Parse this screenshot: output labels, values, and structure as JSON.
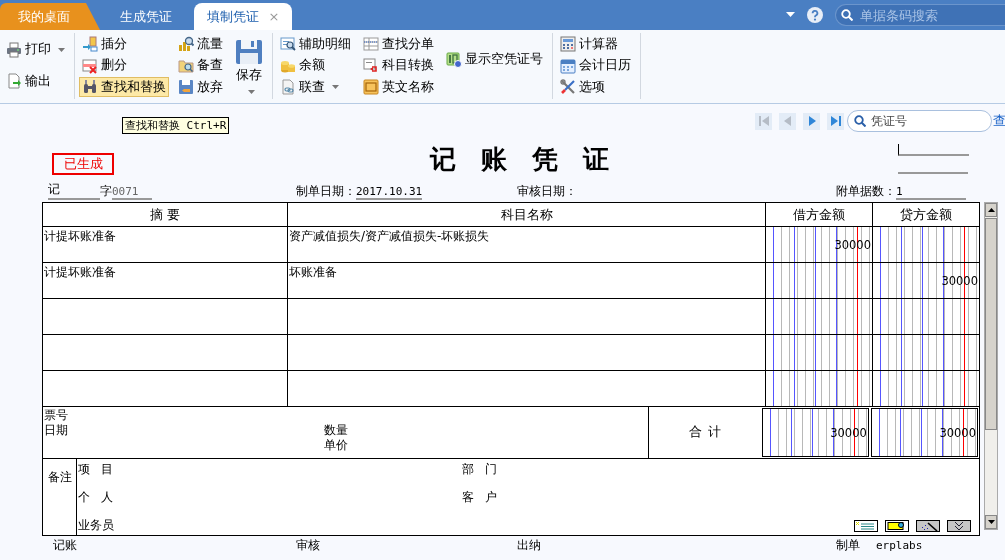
{
  "tabs": [
    {
      "label": "我的桌面",
      "selected": false,
      "kind": "home"
    },
    {
      "label": "生成凭证",
      "selected": false,
      "kind": "normal"
    },
    {
      "label": "填制凭证",
      "selected": true,
      "kind": "normal",
      "close": "×"
    }
  ],
  "barcode_search": {
    "placeholder": "单据条码搜索"
  },
  "ribbon": {
    "groups": [
      {
        "columns": [
          [
            {
              "label": "打印",
              "kind": "small",
              "dropdown": true,
              "hovered": false
            },
            {
              "label": "输出",
              "kind": "small",
              "dropdown": false,
              "hovered": false
            }
          ]
        ]
      },
      {
        "columns": [
          [
            {
              "label": "插分",
              "kind": "small",
              "dropdown": false,
              "hovered": false
            },
            {
              "label": "删分",
              "kind": "small",
              "dropdown": false,
              "hovered": false
            },
            {
              "label": "查找和替换",
              "kind": "small",
              "dropdown": false,
              "hovered": true
            }
          ],
          [
            {
              "label": "流量",
              "kind": "small",
              "dropdown": false,
              "hovered": false
            },
            {
              "label": "备查",
              "kind": "small",
              "dropdown": false,
              "hovered": false
            },
            {
              "label": "放弃",
              "kind": "small",
              "dropdown": false,
              "hovered": false
            }
          ],
          [
            {
              "label": "保存",
              "kind": "large",
              "dropdown": true,
              "hovered": false
            }
          ]
        ]
      },
      {
        "columns": [
          [
            {
              "label": "辅助明细",
              "kind": "small",
              "dropdown": false,
              "hovered": false
            },
            {
              "label": "余额",
              "kind": "small",
              "dropdown": false,
              "hovered": false
            },
            {
              "label": "联查",
              "kind": "small",
              "dropdown": true,
              "hovered": false
            }
          ],
          [
            {
              "label": "查找分单",
              "kind": "small",
              "dropdown": false,
              "hovered": false
            },
            {
              "label": "科目转换",
              "kind": "small",
              "dropdown": false,
              "hovered": false
            },
            {
              "label": "英文名称",
              "kind": "small",
              "dropdown": false,
              "hovered": false
            }
          ],
          [
            {
              "label": "显示空凭证号",
              "kind": "small",
              "dropdown": false,
              "hovered": false
            }
          ]
        ]
      },
      {
        "columns": [
          [
            {
              "label": "计算器",
              "kind": "small",
              "dropdown": false,
              "hovered": false
            },
            {
              "label": "会计日历",
              "kind": "small",
              "dropdown": false,
              "hovered": false
            },
            {
              "label": "选项",
              "kind": "small",
              "dropdown": false,
              "hovered": false
            }
          ]
        ]
      }
    ]
  },
  "tooltip": "查找和替换 Ctrl+R",
  "navigator": {
    "buttons": [
      {
        "kind": "first",
        "disabled": true
      },
      {
        "kind": "prev",
        "disabled": true
      },
      {
        "kind": "next",
        "disabled": false
      },
      {
        "kind": "last",
        "disabled": false
      }
    ],
    "search_placeholder": "凭证号",
    "search_link": "查"
  },
  "voucher": {
    "status": "已生成",
    "title": "记 账 凭 证",
    "type": "记",
    "type_suffix": "字",
    "number": "0071",
    "date_label": "制单日期：",
    "date": "2017.10.31",
    "review_label": "审核日期：",
    "attachments_label": "附单据数：",
    "attachments": "1",
    "columns": [
      "摘 要",
      "科目名称",
      "借方金额",
      "贷方金额"
    ],
    "rows": [
      {
        "summary": "计提坏账准备",
        "account": "资产减值损失/资产减值损失-坏账损失",
        "debit": "30000"
      },
      {
        "summary": "计提坏账准备",
        "account": "坏账准备",
        "credit": "30000"
      }
    ],
    "totals": {
      "ticket_label": "票号",
      "date_label": "日期",
      "quantity_label": "数量",
      "price_label": "单价",
      "label": "合 计",
      "debit": "30000",
      "credit": "30000"
    },
    "remarks": {
      "label": "备注",
      "left_fields": [
        "项   目",
        "个   人",
        "业务员"
      ],
      "right_fields": [
        "部   门",
        "客   户"
      ]
    },
    "signatures": [
      {
        "label": "记账"
      },
      {
        "label": "审核"
      },
      {
        "label": "出纳"
      },
      {
        "label": "制单",
        "value": "erplabs"
      }
    ]
  }
}
